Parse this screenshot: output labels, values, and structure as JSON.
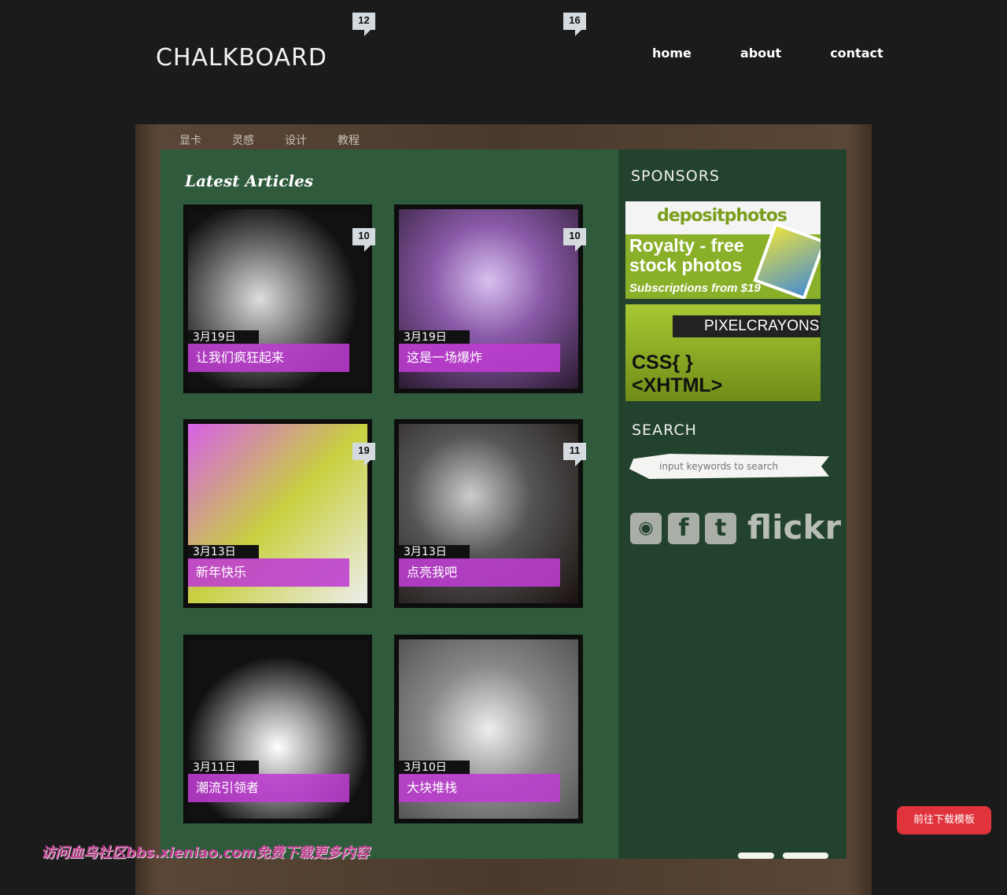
{
  "header": {
    "logo": "CHALKBOARD",
    "bubbles": [
      "12",
      "16"
    ],
    "nav": [
      "home",
      "about",
      "contact"
    ]
  },
  "subnav": [
    "显卡",
    "灵感",
    "设计",
    "教程"
  ],
  "main": {
    "heading": "Latest Articles",
    "articles": [
      {
        "date": "3月19日",
        "title": "让我们疯狂起来",
        "comments": "10"
      },
      {
        "date": "3月19日",
        "title": "这是一场爆炸",
        "comments": "10"
      },
      {
        "date": "3月13日",
        "title": "新年快乐",
        "comments": "19"
      },
      {
        "date": "3月13日",
        "title": "点亮我吧",
        "comments": "11"
      },
      {
        "date": "3月11日",
        "title": "潮流引领者",
        "comments": ""
      },
      {
        "date": "3月10日",
        "title": "大块堆栈",
        "comments": ""
      }
    ]
  },
  "sidebar": {
    "sponsors_title": "SPONSORS",
    "ad1": {
      "brand": "depositphotos",
      "line1": "Royalty - free",
      "line2": "stock photos",
      "line3": "Subscriptions from $19"
    },
    "ad2": {
      "brand": "PIXELCRAYONS",
      "line1": "CSS{ }",
      "line2": "<XHTML>"
    },
    "search_title": "SEARCH",
    "search_placeholder": "input keywords to search",
    "social": [
      "rss-icon",
      "facebook-icon",
      "twitter-icon"
    ],
    "flickr": "flickr"
  },
  "download_button": "前往下载模板",
  "watermark": "访问血鸟社区bbs.xieniao.com免费下载更多内容"
}
